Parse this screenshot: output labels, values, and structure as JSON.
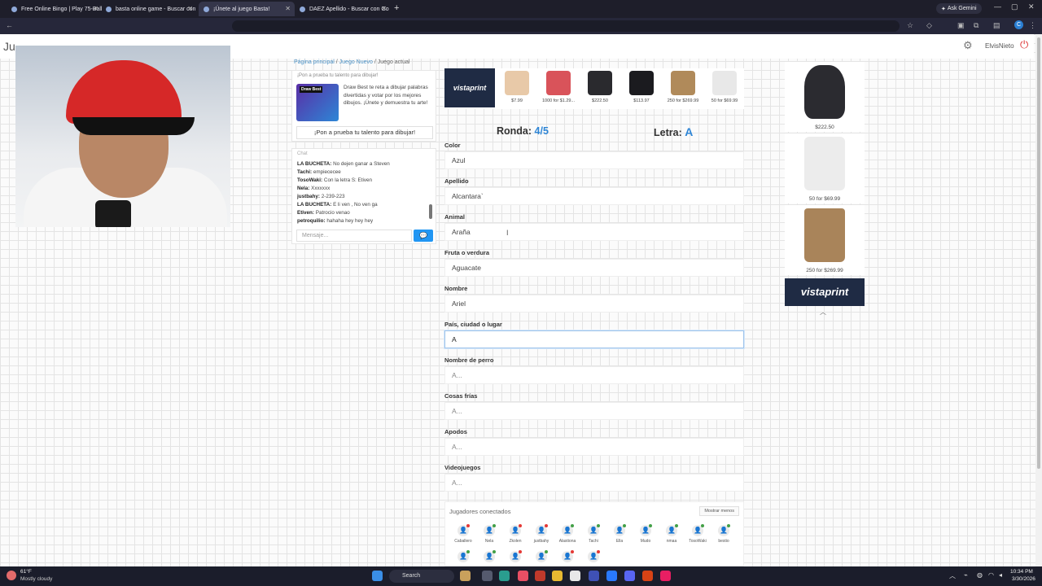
{
  "browser": {
    "tabs": [
      {
        "title": "Free Online Bingo | Play 75-Ball",
        "active": false
      },
      {
        "title": "basta online game - Buscar con",
        "active": false
      },
      {
        "title": "¡Únete al juego Basta!",
        "active": true
      },
      {
        "title": "DAEZ Apellido - Buscar con Go",
        "active": false
      }
    ],
    "gemini_label": "Ask Gemini"
  },
  "page": {
    "logo_text": "Ju",
    "username": "ElvisNieto",
    "breadcrumb": {
      "home": "Página principal",
      "new_game": "Juego Nuevo",
      "current": "Juego actual"
    }
  },
  "promo": {
    "heading": "¡Pon a prueba tu talento para dibujar!",
    "image_title": "Draw Best",
    "text": "Draw Best te reta a dibujar palabras divertidas y votar por los mejores dibujos. ¡Únete y demuestra tu arte!",
    "button": "¡Pon a prueba tu talento para dibujar!"
  },
  "chat": {
    "heading": "Chat",
    "messages": [
      {
        "user": "LA BUCHETA:",
        "text": "No dejen ganar a Steven"
      },
      {
        "user": "Tachi:",
        "text": "empiececee"
      },
      {
        "user": "TosoWaki:",
        "text": "Con la letra S: Etiven"
      },
      {
        "user": "Nela:",
        "text": "Xxxxxxx"
      },
      {
        "user": "justbahy:",
        "text": "2-239-223"
      },
      {
        "user": "LA BUCHETA:",
        "text": "E li ven , No ven ga"
      },
      {
        "user": "Etiven:",
        "text": "Patrocio venao"
      },
      {
        "user": "petroquilio:",
        "text": "hahaha hey hey hey"
      }
    ],
    "input_placeholder": "Mensaje..."
  },
  "ads": {
    "brand": "vistaprint",
    "items": [
      {
        "price": "$7.99",
        "color": "#e8c9a8"
      },
      {
        "price": "1000 for $1.29...",
        "color": "#d9535a"
      },
      {
        "price": "$222.50",
        "color": "#2a2a2e"
      },
      {
        "price": "$113.97",
        "color": "#1b1b1f"
      },
      {
        "price": "250 for $269.99",
        "color": "#b08a5a"
      },
      {
        "price": "50 for $69.99",
        "color": "#e8e8e8"
      }
    ],
    "sidebar": [
      {
        "price": "$222.50",
        "color": "#2b2b30"
      },
      {
        "price": "50 for $69.99",
        "color": "#ececec"
      },
      {
        "price": "250 for $269.99",
        "color": "#a9845a"
      }
    ]
  },
  "game": {
    "round_label": "Ronda:",
    "round_value": "4/5",
    "letter_label": "Letra:",
    "letter_value": "A"
  },
  "fields": [
    {
      "label": "Color",
      "value": "Azul",
      "placeholder": false,
      "focused": false
    },
    {
      "label": "Apellido",
      "value": "Alcantara`",
      "placeholder": false,
      "focused": false
    },
    {
      "label": "Animal",
      "value": "Araña",
      "placeholder": false,
      "focused": false
    },
    {
      "label": "Fruta o verdura",
      "value": "Aguacate",
      "placeholder": false,
      "focused": false
    },
    {
      "label": "Nombre",
      "value": "Ariel",
      "placeholder": false,
      "focused": false
    },
    {
      "label": "País, ciudad o lugar",
      "value": "A",
      "placeholder": false,
      "focused": true
    },
    {
      "label": "Nombre de perro",
      "value": "A...",
      "placeholder": true,
      "focused": false
    },
    {
      "label": "Cosas frías",
      "value": "A...",
      "placeholder": true,
      "focused": false
    },
    {
      "label": "Apodos",
      "value": "A...",
      "placeholder": true,
      "focused": false
    },
    {
      "label": "Videojuegos",
      "value": "A...",
      "placeholder": true,
      "focused": false
    }
  ],
  "players": {
    "title": "Jugadores conectados",
    "toggle": "Mostrar menos",
    "list": [
      {
        "name": "Caballero",
        "status": "#e53935"
      },
      {
        "name": "Nela",
        "status": "#43a047"
      },
      {
        "name": "Zkolen",
        "status": "#e53935"
      },
      {
        "name": "justbahy",
        "status": "#e53935"
      },
      {
        "name": "Alastiona",
        "status": "#43a047"
      },
      {
        "name": "Tachi",
        "status": "#43a047"
      },
      {
        "name": "Ella",
        "status": "#43a047"
      },
      {
        "name": "Mudo",
        "status": "#43a047"
      },
      {
        "name": "nmaa",
        "status": "#43a047"
      },
      {
        "name": "TosoWaki",
        "status": "#43a047"
      },
      {
        "name": "bestio",
        "status": "#43a047"
      },
      {
        "name": "",
        "status": "#43a047"
      },
      {
        "name": "",
        "status": "#43a047"
      },
      {
        "name": "",
        "status": "#e53935"
      },
      {
        "name": "",
        "status": "#43a047"
      },
      {
        "name": "",
        "status": "#e53935"
      },
      {
        "name": "",
        "status": "#e53935"
      }
    ]
  },
  "taskbar": {
    "temp": "61°F",
    "condition": "Mostly cloudy",
    "search": "Search",
    "time": "10:34 PM",
    "date": "3/30/2026"
  }
}
